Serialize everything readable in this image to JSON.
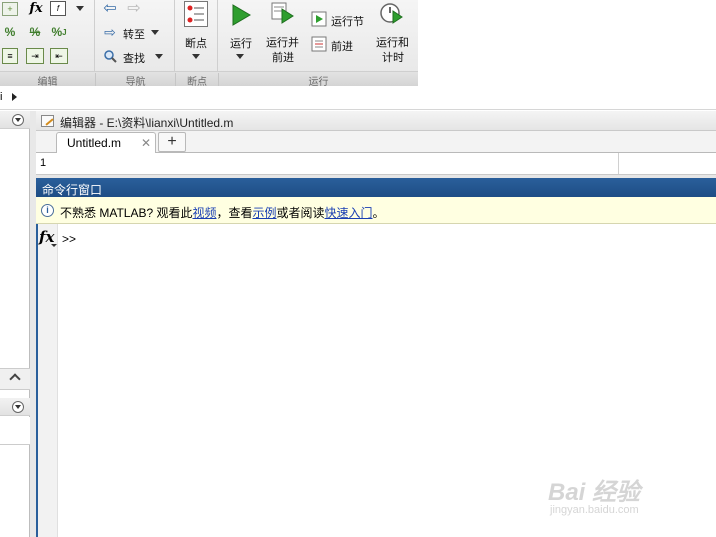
{
  "toolstrip": {
    "groups": {
      "edit": "编辑",
      "navigate": "导航",
      "breakpoints": "断点",
      "run": "运行"
    },
    "fx_glyph": "fx",
    "percent_glyph": "%",
    "goto_label": "转至",
    "find_label": "查找",
    "breakpoints_label": "断点",
    "run_label": "运行",
    "run_advance_label_1": "运行并",
    "run_advance_label_2": "前进",
    "run_section_label": "运行节",
    "advance_label": "前进",
    "run_time_label_1": "运行和",
    "run_time_label_2": "计时",
    "colors": {
      "run_green": "#2e9e2e",
      "nav_blue": "#3a6ea8"
    }
  },
  "addressbar": {
    "text": "i"
  },
  "editor": {
    "title": "编辑器 - E:\\资料\\lianxi\\Untitled.m",
    "tab_label": "Untitled.m",
    "tab_close": "✕",
    "new_tab": "+",
    "line_number": "1"
  },
  "command_window": {
    "title": "命令行窗口",
    "info_icon": "i",
    "info_prefix": "不熟悉 MATLAB? 观看此",
    "info_link_video": "视频",
    "info_mid1": "，查看",
    "info_link_examples": "示例",
    "info_mid2": "或者阅读",
    "info_link_getting_started": "快速入门",
    "info_suffix": "。",
    "fx_label": "fx",
    "prompt": ">>",
    "title_color": "#2a5f9b",
    "info_bg": "#ffffe1"
  },
  "watermark": {
    "brand": "Bai 经验",
    "url": "jingyan.baidu.com"
  }
}
